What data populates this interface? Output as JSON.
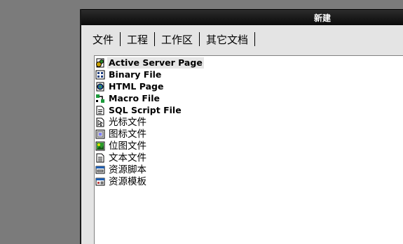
{
  "dialog": {
    "title": "新建"
  },
  "tabs": [
    "文件",
    "工程",
    "工作区",
    "其它文档"
  ],
  "items": [
    {
      "label": "Active Server Page",
      "icon": "asp-file-icon"
    },
    {
      "label": "Binary File",
      "icon": "binary-file-icon"
    },
    {
      "label": "HTML Page",
      "icon": "html-page-icon"
    },
    {
      "label": "Macro File",
      "icon": "macro-file-icon"
    },
    {
      "label": "SQL Script File",
      "icon": "sql-script-icon"
    },
    {
      "label": "光标文件",
      "icon": "cursor-file-icon"
    },
    {
      "label": "图标文件",
      "icon": "icon-file-icon"
    },
    {
      "label": "位图文件",
      "icon": "bitmap-file-icon"
    },
    {
      "label": "文本文件",
      "icon": "text-file-icon"
    },
    {
      "label": "资源脚本",
      "icon": "resource-script-icon"
    },
    {
      "label": "资源模板",
      "icon": "resource-template-icon"
    }
  ]
}
